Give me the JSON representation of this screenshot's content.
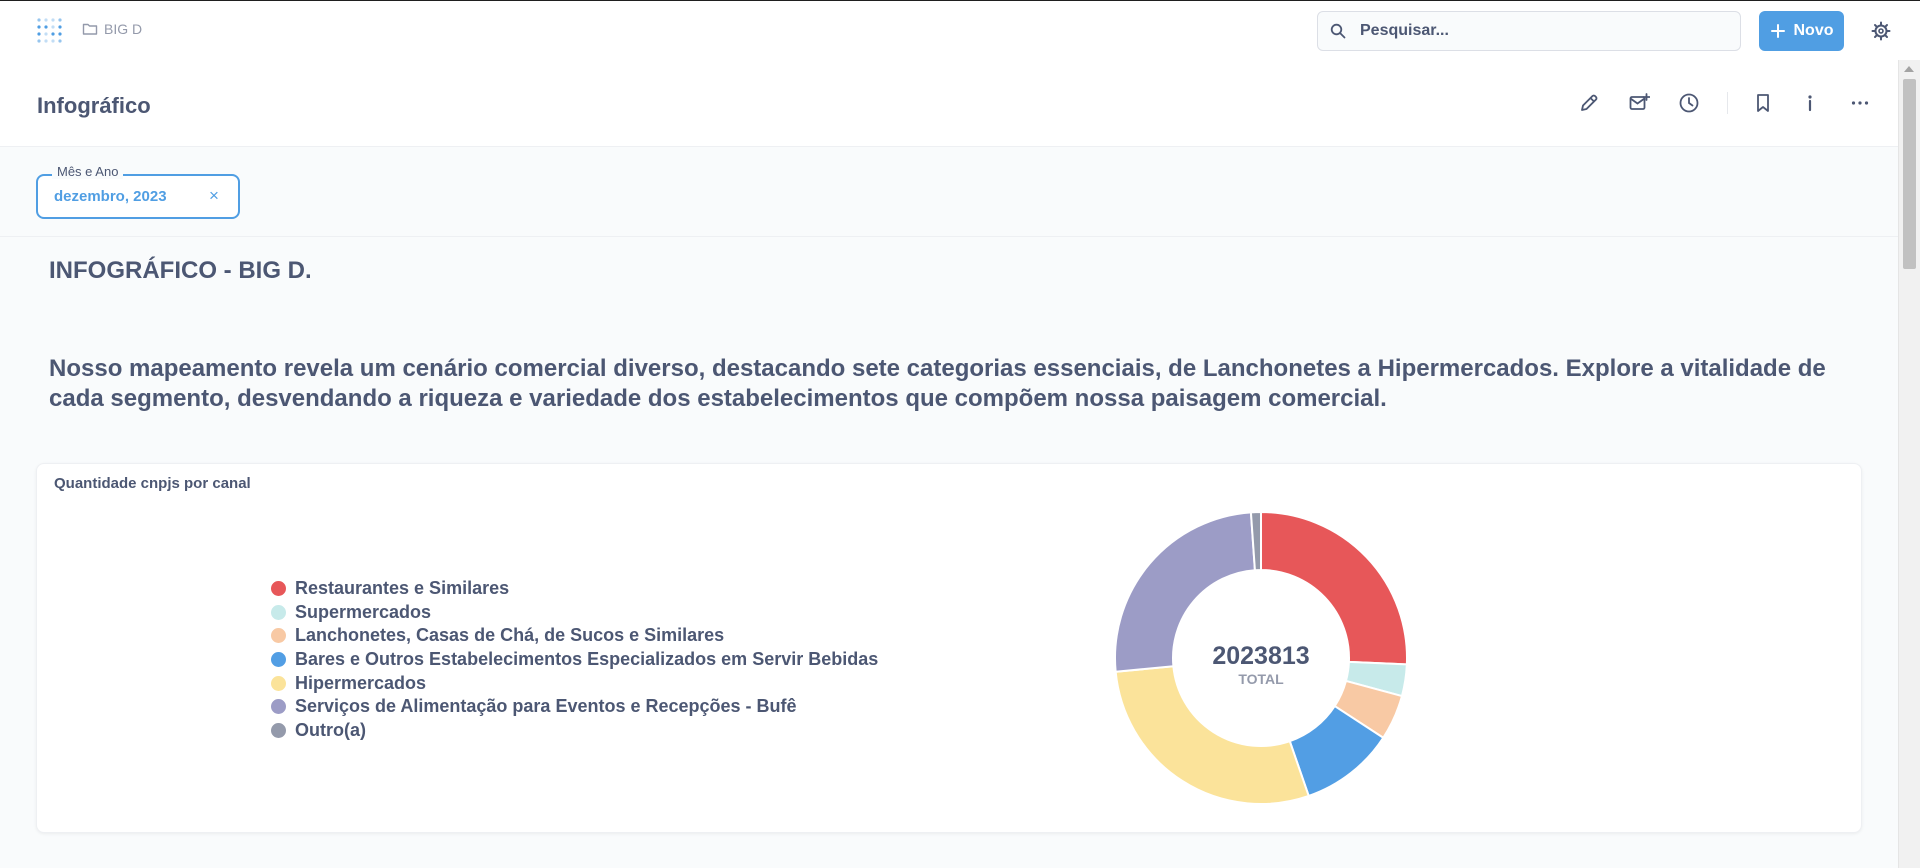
{
  "nav": {
    "breadcrumb": "BIG D",
    "search_placeholder": "Pesquisar...",
    "new_button": "Novo"
  },
  "header": {
    "title": "Infográfico"
  },
  "filter": {
    "label": "Mês e Ano",
    "value": "dezembro, 2023",
    "clear": "×"
  },
  "content": {
    "headline": "INFOGRÁFICO - BIG D.",
    "intro": "Nosso mapeamento revela um cenário comercial diverso, destacando sete categorias essenciais, de Lanchonetes a Hipermercados. Explore a vitalidade de cada segmento, desvendando a riqueza e variedade dos estabelecimentos que compõem nossa paisagem comercial."
  },
  "card": {
    "title": "Quantidade cnpjs por canal"
  },
  "chart_data": {
    "type": "pie",
    "donut": true,
    "title": "Quantidade cnpjs por canal",
    "total": "2023813",
    "total_label": "TOTAL",
    "legend_position": "left",
    "categories": [
      "Restaurantes e Similares",
      "Supermercados",
      "Lanchonetes, Casas de Chá, de Sucos e Similares",
      "Bares e Outros Estabelecimentos Especializados em Servir Bebidas",
      "Hipermercados",
      "Serviços de Alimentação para Eventos e Recepções - Bufê",
      "Outro(a)"
    ],
    "values": [
      25.7,
      3.5,
      5.0,
      10.5,
      28.8,
      25.4,
      1.1
    ],
    "colors": [
      "#e75759",
      "#c7eaea",
      "#f8c9a4",
      "#529ee4",
      "#fbe39a",
      "#9c9cc6",
      "#949aab"
    ]
  }
}
